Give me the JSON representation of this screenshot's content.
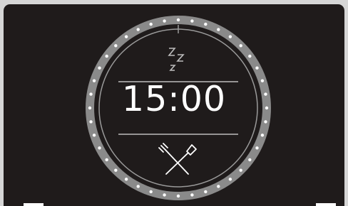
{
  "display": {
    "timer_value": "15:00",
    "status_icon": "sleep-zzz-icon",
    "mode_icon": "crossed-fork-spatula-icon"
  },
  "colors": {
    "screen_background": "#1f1b1b",
    "ring_color": "#8a8a8a",
    "foreground": "#ffffff"
  },
  "icons": {
    "sleep": "zzz",
    "mode": "fork-and-spatula"
  }
}
